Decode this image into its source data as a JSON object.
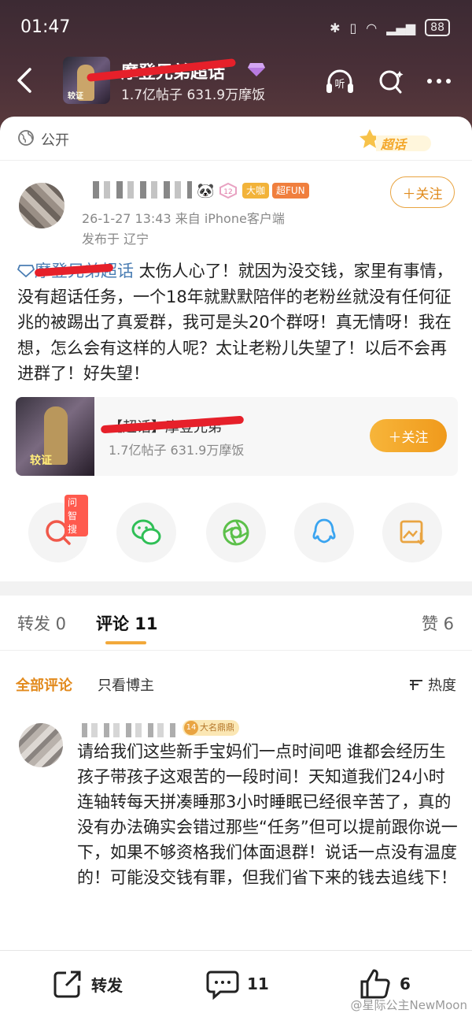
{
  "status_bar": {
    "time": "01:47",
    "battery": "88"
  },
  "topic_header": {
    "title": "摩登兄弟超话",
    "stats": "1.7亿帖子 631.9万摩饭",
    "thumb_tag": "较证",
    "listen_label": "听"
  },
  "post": {
    "visibility": "公开",
    "chaohua_badge": "超话",
    "badges": {
      "level": "12",
      "big_coffee": "大咖",
      "super_fun": "超FUN"
    },
    "meta_time": "26-1-27 13:43  来自 iPhone客户端",
    "meta_location": "发布于 辽宁",
    "follow_label": "＋关注",
    "topic_link": "摩登兄弟超话",
    "text": "  太伤人心了！就因为没交钱，家里有事情，没有超话任务，一个18年就默默陪伴的老粉丝就没有任何征兆的被踢出了真爱群，我可是头20个群呀！真无情呀！我在想，怎么会有这样的人呢？太让老粉儿失望了！以后不会再进群了！好失望！"
  },
  "topic_card": {
    "title": "【超话】摩登兄弟",
    "stats": "1.7亿帖子 631.9万摩饭",
    "thumb_tag": "较证",
    "follow_label": "＋关注"
  },
  "share": {
    "ask_tag": "问智搜",
    "icons": [
      "ask-search-icon",
      "wechat-icon",
      "moments-icon",
      "qq-icon",
      "save-image-icon"
    ]
  },
  "tabs": {
    "repost": "转发 0",
    "comment": "评论 11",
    "like": "赞 6"
  },
  "comment_filter": {
    "all": "全部评论",
    "owner_only": "只看博主",
    "sort": "热度"
  },
  "comment": {
    "badge_num": "14",
    "badge_text": "大名鼎鼎",
    "text": "请给我们这些新手宝妈们一点时间吧  谁都会经历生孩子带孩子这艰苦的一段时间！天知道我们24小时连轴转每天拼凑睡那3小时睡眠已经很辛苦了，真的没有办法确实会错过那些“任务”但可以提前跟你说一下，如果不够资格我们体面退群！说话一点没有温度的！可能没交钱有罪，但我们省下来的钱去追线下！"
  },
  "bottom_bar": {
    "repost": "转发",
    "comment": "11",
    "like": "6",
    "watermark": "@星际公主NewMoon"
  },
  "colors": {
    "accent": "#f2a93b",
    "link": "#4a7db3",
    "redaction": "#e6202a"
  }
}
